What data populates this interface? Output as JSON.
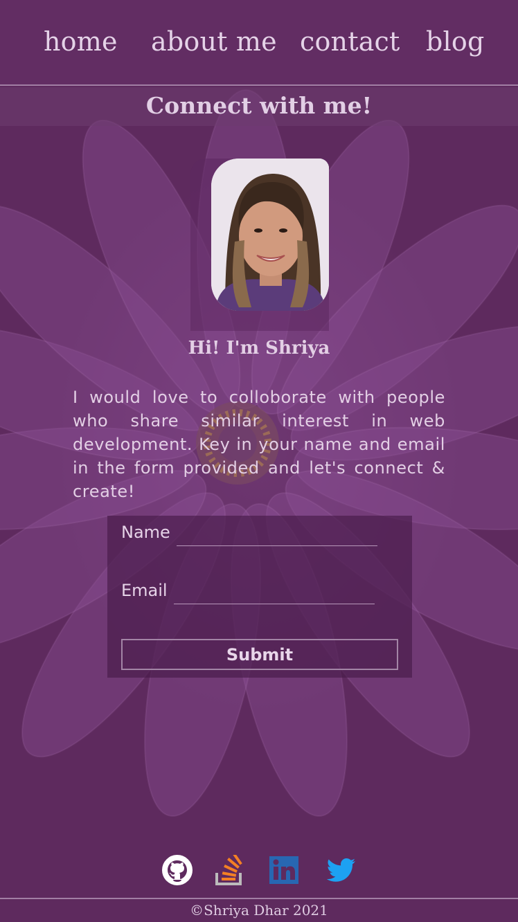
{
  "nav": {
    "items": [
      {
        "label": "home"
      },
      {
        "label": "about me"
      },
      {
        "label": "contact"
      },
      {
        "label": "blog"
      }
    ]
  },
  "banner": {
    "title": "Connect with me!"
  },
  "profile": {
    "greeting": "Hi! I'm Shriya",
    "intro": "I would love to colloborate with people who share similar interest in web development. Key in your name and email in the form provided and let's connect & create!"
  },
  "form": {
    "name_label": "Name",
    "name_value": "",
    "email_label": "Email",
    "email_value": "",
    "submit_label": "Submit"
  },
  "social": [
    {
      "icon": "github-icon"
    },
    {
      "icon": "stackoverflow-icon"
    },
    {
      "icon": "linkedin-icon"
    },
    {
      "icon": "twitter-icon"
    }
  ],
  "footer": {
    "copyright": "©Shriya Dhar 2021"
  },
  "colors": {
    "background": "#5e2a5e",
    "text": "#e3cfe5",
    "form_bg": "#461a48",
    "stack_orange": "#f48024",
    "linkedin_blue": "#2867b2",
    "twitter_blue": "#1da1f2"
  }
}
